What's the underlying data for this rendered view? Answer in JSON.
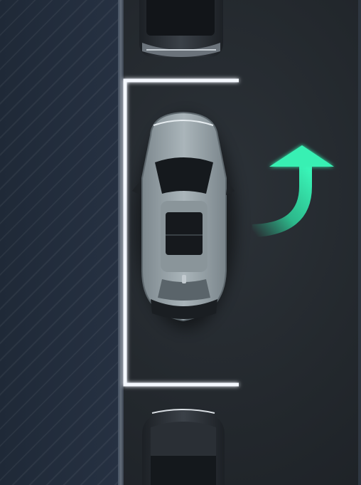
{
  "scene": {
    "title": "",
    "guidance": {
      "arrow": "turn-right-then-forward-arrow",
      "accent_color": "#2ee6a8",
      "bay_line_color": "#f4f8ff"
    },
    "vehicles": [
      {
        "role": "parked-vehicle-front",
        "color": "#3a3f45"
      },
      {
        "role": "ego-vehicle",
        "color": "#9aa6ac"
      },
      {
        "role": "parked-vehicle-rear",
        "color": "#3a3f45"
      }
    ]
  }
}
